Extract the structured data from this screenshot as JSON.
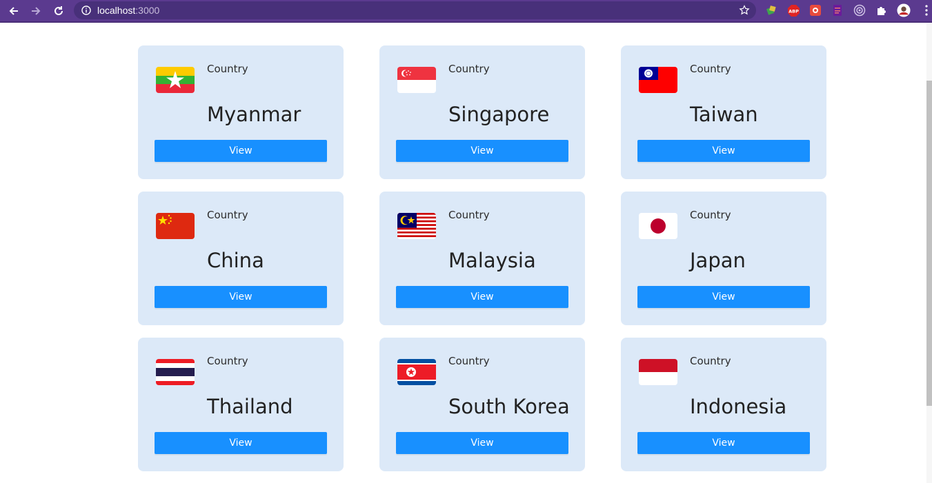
{
  "browser": {
    "url_host": "localhost",
    "url_port": ":3000",
    "accent": "#5b3a8f"
  },
  "countries": [
    {
      "label": "Country",
      "name": "Myanmar",
      "button": "View",
      "flag": "myanmar"
    },
    {
      "label": "Country",
      "name": "Singapore",
      "button": "View",
      "flag": "singapore"
    },
    {
      "label": "Country",
      "name": "Taiwan",
      "button": "View",
      "flag": "taiwan"
    },
    {
      "label": "Country",
      "name": "China",
      "button": "View",
      "flag": "china"
    },
    {
      "label": "Country",
      "name": "Malaysia",
      "button": "View",
      "flag": "malaysia"
    },
    {
      "label": "Country",
      "name": "Japan",
      "button": "View",
      "flag": "japan"
    },
    {
      "label": "Country",
      "name": "Thailand",
      "button": "View",
      "flag": "thailand"
    },
    {
      "label": "Country",
      "name": "South Korea",
      "button": "View",
      "flag": "south-korea"
    },
    {
      "label": "Country",
      "name": "Indonesia",
      "button": "View",
      "flag": "indonesia"
    }
  ],
  "colors": {
    "card_bg": "#dce9f8",
    "button_bg": "#1890ff"
  }
}
